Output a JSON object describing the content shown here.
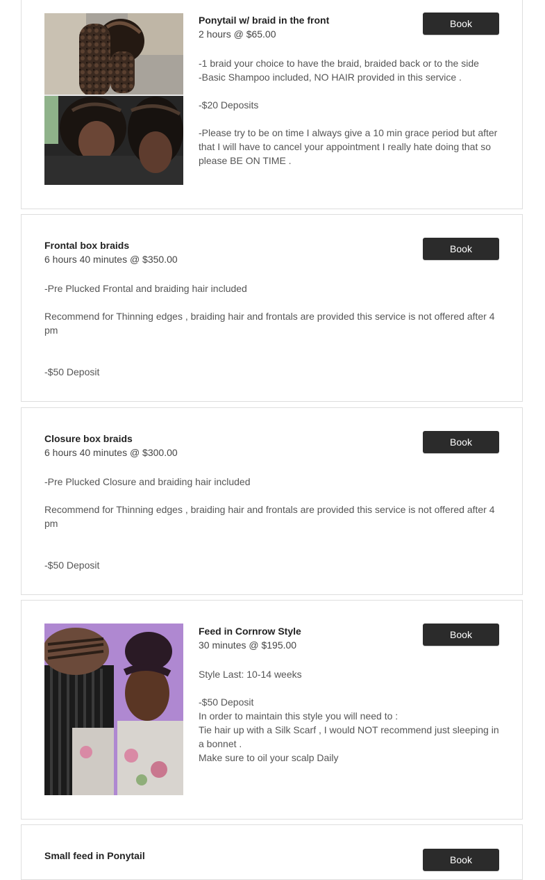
{
  "services": [
    {
      "title": "Ponytail w/ braid in the front",
      "meta": "2 hours @ $65.00",
      "book_label": "Book",
      "lines": [
        "-1 braid your choice to have the braid, braided back or to the side",
        "-Basic Shampoo included, NO HAIR provided in this service .",
        "",
        "-$20 Deposits",
        "",
        "-Please try to be on time I always give a 10 min grace period but after that I will have to cancel your appointment I really hate doing that so please BE ON TIME ."
      ]
    },
    {
      "title": "Frontal box braids",
      "meta": "6 hours 40 minutes @ $350.00",
      "book_label": "Book",
      "lines": [
        "-Pre Plucked Frontal and braiding hair included",
        "",
        "Recommend for Thinning edges , braiding hair and frontals are provided this service is not offered after 4 pm",
        "",
        "",
        "-$50 Deposit"
      ]
    },
    {
      "title": "Closure box braids",
      "meta": "6 hours 40 minutes @ $300.00",
      "book_label": "Book",
      "lines": [
        "-Pre Plucked Closure and braiding hair included",
        "",
        "Recommend for Thinning edges , braiding hair and frontals are provided this service is not offered after 4 pm",
        "",
        "",
        "-$50 Deposit"
      ]
    },
    {
      "title": "Feed in Cornrow Style",
      "meta": "30 minutes @ $195.00",
      "book_label": "Book",
      "lines": [
        "Style Last: 10-14 weeks",
        "",
        "-$50 Deposit",
        "In order to maintain this style you will need to :",
        "Tie hair up with a Silk Scarf , I would NOT recommend just sleeping in a bonnet .",
        "Make sure to oil your scalp Daily"
      ]
    },
    {
      "title": "Small feed in Ponytail",
      "meta": "",
      "book_label": "Book",
      "lines": []
    }
  ]
}
